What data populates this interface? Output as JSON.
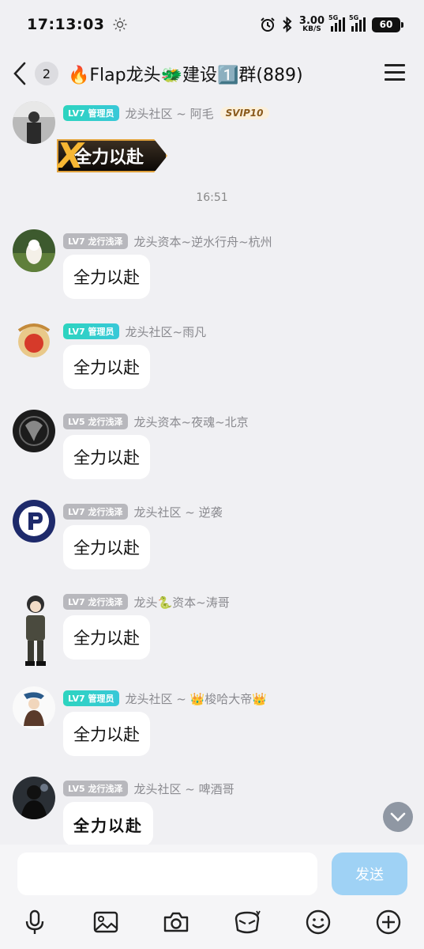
{
  "status_bar": {
    "time": "17:13:03",
    "net_speed_value": "3.00",
    "net_speed_unit": "KB/S",
    "signal1_tag": "5G",
    "signal2_tag": "5G",
    "battery": "60"
  },
  "header": {
    "unread_count": "2",
    "title": "🔥Flap龙头🐲建设1️⃣群(889)"
  },
  "chat": {
    "timestamp": "16:51",
    "messages": [
      {
        "level": "LV7 管理员",
        "level_type": "admin",
        "name": "龙头社区 ~ 阿毛",
        "badge": "SVIP10",
        "content": "全力以赴",
        "kind": "sticker"
      },
      {
        "level": "LV7 龙行浅泽",
        "level_type": "grey",
        "name": "龙头资本~逆水行舟~杭州",
        "content": "全力以赴"
      },
      {
        "level": "LV7 管理员",
        "level_type": "admin",
        "name": "龙头社区~雨凡",
        "content": "全力以赴"
      },
      {
        "level": "LV5 龙行浅泽",
        "level_type": "grey",
        "name": "龙头资本~夜魂~北京",
        "content": "全力以赴"
      },
      {
        "level": "LV7 龙行浅泽",
        "level_type": "grey",
        "name": "龙头社区 ~ 逆袭",
        "content": "全力以赴"
      },
      {
        "level": "LV7 龙行浅泽",
        "level_type": "grey",
        "name": "龙头🐍资本~涛哥",
        "content": "全力以赴"
      },
      {
        "level": "LV7 管理员",
        "level_type": "admin",
        "name": "龙头社区 ~ 👑梭哈大帝👑",
        "content": "全力以赴"
      },
      {
        "level": "LV5 龙行浅泽",
        "level_type": "grey",
        "name": "龙头社区 ~ 啤酒哥",
        "content": "全力以赴",
        "kind": "handwritten"
      }
    ]
  },
  "input": {
    "placeholder": "",
    "send_label": "发送"
  },
  "icons": {
    "toolbar": [
      "microphone-icon",
      "image-icon",
      "camera-icon",
      "red-packet-icon",
      "emoji-icon",
      "plus-icon"
    ]
  },
  "colors": {
    "admin_badge": "#2dd4bf",
    "member_badge": "#b8b8bd",
    "send_button": "#9fd2f5",
    "background": "#f0f0f3"
  }
}
